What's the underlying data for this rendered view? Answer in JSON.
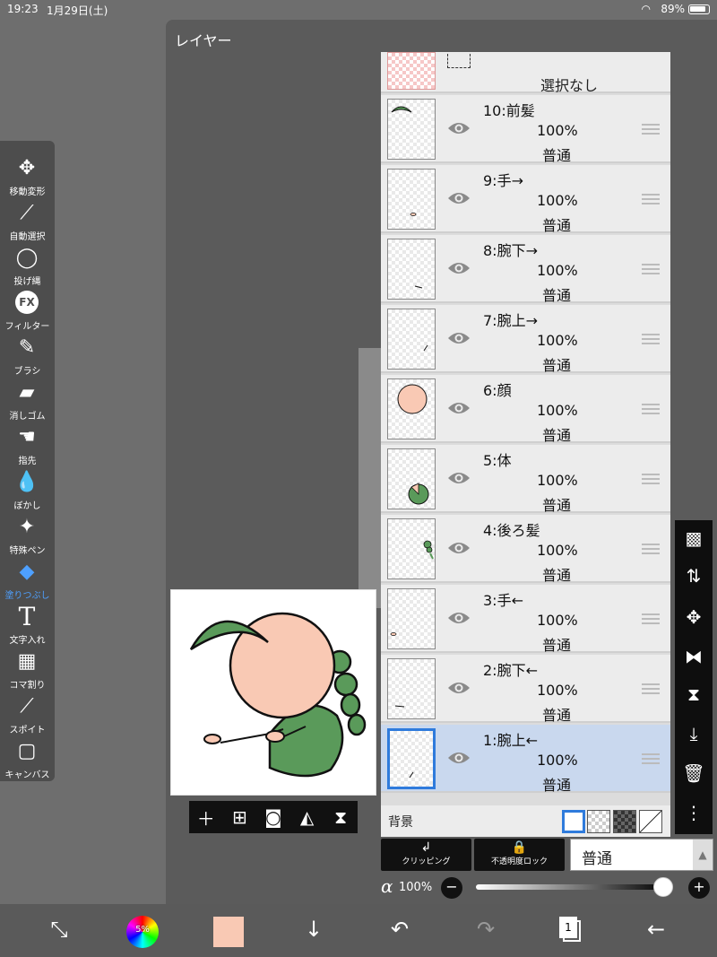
{
  "status": {
    "time": "19:23",
    "date": "1月29日(土)",
    "battery": "89%"
  },
  "window": {
    "title": "レイヤー"
  },
  "tools": [
    {
      "label": "移動変形",
      "icon": "move-icon"
    },
    {
      "label": "自動選択",
      "icon": "magic-wand-icon"
    },
    {
      "label": "投げ縄",
      "icon": "lasso-icon"
    },
    {
      "label": "フィルター",
      "icon": "fx-icon"
    },
    {
      "label": "ブラシ",
      "icon": "brush-icon"
    },
    {
      "label": "消しゴム",
      "icon": "eraser-icon"
    },
    {
      "label": "指先",
      "icon": "finger-icon"
    },
    {
      "label": "ぼかし",
      "icon": "blur-drop-icon"
    },
    {
      "label": "特殊ペン",
      "icon": "special-pen-icon"
    },
    {
      "label": "塗りつぶし",
      "icon": "bucket-icon",
      "active": true
    },
    {
      "label": "文字入れ",
      "icon": "text-icon"
    },
    {
      "label": "コマ割り",
      "icon": "frame-divide-icon"
    },
    {
      "label": "スポイト",
      "icon": "eyedropper-icon"
    },
    {
      "label": "キャンバス",
      "icon": "canvas-icon"
    }
  ],
  "selection_layer": {
    "label": "選択なし"
  },
  "layers": [
    {
      "name": "10:前髪",
      "opacity": "100%",
      "blend": "普通"
    },
    {
      "name": "9:手→",
      "opacity": "100%",
      "blend": "普通"
    },
    {
      "name": "8:腕下→",
      "opacity": "100%",
      "blend": "普通"
    },
    {
      "name": "7:腕上→",
      "opacity": "100%",
      "blend": "普通"
    },
    {
      "name": "6:顔",
      "opacity": "100%",
      "blend": "普通"
    },
    {
      "name": "5:体",
      "opacity": "100%",
      "blend": "普通"
    },
    {
      "name": "4:後ろ髪",
      "opacity": "100%",
      "blend": "普通"
    },
    {
      "name": "3:手←",
      "opacity": "100%",
      "blend": "普通"
    },
    {
      "name": "2:腕下←",
      "opacity": "100%",
      "blend": "普通"
    },
    {
      "name": "1:腕上←",
      "opacity": "100%",
      "blend": "普通",
      "selected": true
    }
  ],
  "background": {
    "label": "背景"
  },
  "controls": {
    "clipping_label": "クリッピング",
    "lock_label": "不透明度ロック",
    "blend_mode": "普通",
    "alpha_symbol": "α",
    "opacity": "100%",
    "opacity_value": 1.0
  },
  "bottombar": {
    "color_wheel_label": "5%",
    "pages_count": "1",
    "current_color": "#f9c9b4"
  },
  "colors": {
    "accent": "#2f7bdc",
    "active_tool": "#4ea0ff",
    "hair": "#5a9a5a",
    "skin": "#f9c9b4"
  }
}
